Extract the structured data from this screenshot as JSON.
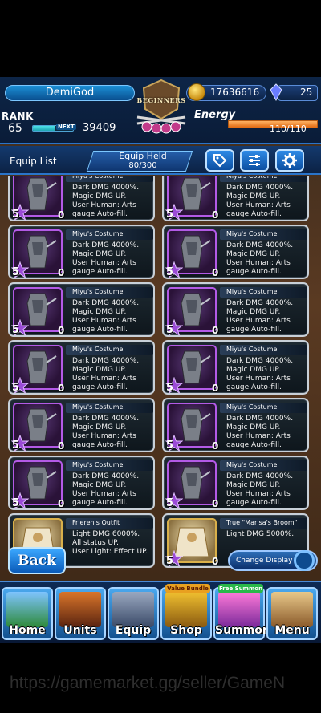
{
  "header": {
    "player_name": "DemiGod",
    "rank_label": "RANK",
    "rank_value": "65",
    "next_label": "NEXT",
    "exp_fill_percent": 55,
    "exp_value": "39409",
    "emblem_text": "BEGINNERS",
    "gold_value": "17636616",
    "gem_value": "25",
    "energy_label": "Energy",
    "energy_value": "110/110",
    "energy_fill_percent": 100
  },
  "equip_bar": {
    "list_label": "Equip List",
    "held_label": "Equip Held",
    "held_value": "80/300",
    "buttons": [
      "tag-icon",
      "sliders-icon",
      "gear-icon"
    ]
  },
  "cards": [
    {
      "name": "Miyu's Costume",
      "desc": [
        "Dark DMG 4000%.",
        "Magic DMG UP.",
        "User Human: Arts",
        "gauge Auto-fill."
      ],
      "stars": "5",
      "level": "0",
      "thumb": "dark-armor"
    },
    {
      "name": "Miyu's Costume",
      "desc": [
        "Dark DMG 4000%.",
        "Magic DMG UP.",
        "User Human: Arts",
        "gauge Auto-fill."
      ],
      "stars": "5",
      "level": "0",
      "thumb": "dark-armor"
    },
    {
      "name": "Miyu's Costume",
      "desc": [
        "Dark DMG 4000%.",
        "Magic DMG UP.",
        "User Human: Arts",
        "gauge Auto-fill."
      ],
      "stars": "5",
      "level": "0",
      "thumb": "dark-armor"
    },
    {
      "name": "Miyu's Costume",
      "desc": [
        "Dark DMG 4000%.",
        "Magic DMG UP.",
        "User Human: Arts",
        "gauge Auto-fill."
      ],
      "stars": "5",
      "level": "0",
      "thumb": "dark-armor"
    },
    {
      "name": "Miyu's Costume",
      "desc": [
        "Dark DMG 4000%.",
        "Magic DMG UP.",
        "User Human: Arts",
        "gauge Auto-fill."
      ],
      "stars": "5",
      "level": "0",
      "thumb": "dark-armor"
    },
    {
      "name": "Miyu's Costume",
      "desc": [
        "Dark DMG 4000%.",
        "Magic DMG UP.",
        "User Human: Arts",
        "gauge Auto-fill."
      ],
      "stars": "5",
      "level": "0",
      "thumb": "dark-armor"
    },
    {
      "name": "Miyu's Costume",
      "desc": [
        "Dark DMG 4000%.",
        "Magic DMG UP.",
        "User Human: Arts",
        "gauge Auto-fill."
      ],
      "stars": "5",
      "level": "0",
      "thumb": "dark-armor"
    },
    {
      "name": "Miyu's Costume",
      "desc": [
        "Dark DMG 4000%.",
        "Magic DMG UP.",
        "User Human: Arts",
        "gauge Auto-fill."
      ],
      "stars": "5",
      "level": "0",
      "thumb": "dark-armor"
    },
    {
      "name": "Miyu's Costume",
      "desc": [
        "Dark DMG 4000%.",
        "Magic DMG UP.",
        "User Human: Arts",
        "gauge Auto-fill."
      ],
      "stars": "5",
      "level": "0",
      "thumb": "dark-armor"
    },
    {
      "name": "Miyu's Costume",
      "desc": [
        "Dark DMG 4000%.",
        "Magic DMG UP.",
        "User Human: Arts",
        "gauge Auto-fill."
      ],
      "stars": "5",
      "level": "0",
      "thumb": "dark-armor"
    },
    {
      "name": "Miyu's Costume",
      "desc": [
        "Dark DMG 4000%.",
        "Magic DMG UP.",
        "User Human: Arts",
        "gauge Auto-fill."
      ],
      "stars": "5",
      "level": "0",
      "thumb": "dark-armor"
    },
    {
      "name": "Miyu's Costume",
      "desc": [
        "Dark DMG 4000%.",
        "Magic DMG UP.",
        "User Human: Arts",
        "gauge Auto-fill."
      ],
      "stars": "5",
      "level": "0",
      "thumb": "dark-armor"
    },
    {
      "name": "Frieren's Outfit",
      "desc": [
        "Light DMG 6000%.",
        "All status UP.",
        "User Light: Effect UP."
      ],
      "stars": "5",
      "level": "0",
      "thumb": "light-outfit"
    },
    {
      "name": "True \"Marisa's Broom\"",
      "desc": [
        "Light DMG 5000%."
      ],
      "stars": "5",
      "level": "0",
      "thumb": "light-broom"
    }
  ],
  "bottom": {
    "back_label": "Back",
    "change_display_label": "Change Display"
  },
  "nav": [
    {
      "label": "Home",
      "badge": ""
    },
    {
      "label": "Units",
      "badge": ""
    },
    {
      "label": "Equip",
      "badge": ""
    },
    {
      "label": "Shop",
      "badge": "Value Bundle"
    },
    {
      "label": "Summon",
      "badge": "Free Summon"
    },
    {
      "label": "Menu",
      "badge": ""
    }
  ],
  "watermark": "https://gamemarket.gg/seller/GameN",
  "colors": {
    "accent_blue": "#2a74c9",
    "energy_orange": "#e06a12",
    "gold": "#d9b04a",
    "rarity_purple": "#b35ae6"
  }
}
